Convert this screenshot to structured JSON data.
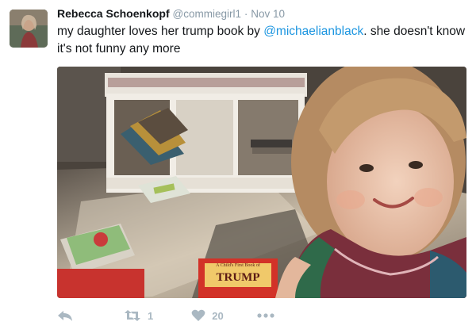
{
  "tweet": {
    "display_name": "Rebecca Schoenkopf",
    "handle": "@commiegirl1",
    "separator": "·",
    "timestamp": "Nov 10",
    "text_before": "my daughter loves her trump book by ",
    "mention": "@michaelianblack",
    "text_after": ". she doesn't know it's not funny any more"
  },
  "media": {
    "book_cover_title": "TRUMP",
    "book_cover_subtitle": "A Child's First Book of"
  },
  "actions": {
    "reply_icon": "reply-icon",
    "retweet_icon": "retweet-icon",
    "retweet_count": "1",
    "like_icon": "heart-icon",
    "like_count": "20",
    "more_icon": "more-icon"
  },
  "colors": {
    "mention": "#1b95e0",
    "muted": "#8899a6",
    "action_icon": "#aab8c2"
  }
}
